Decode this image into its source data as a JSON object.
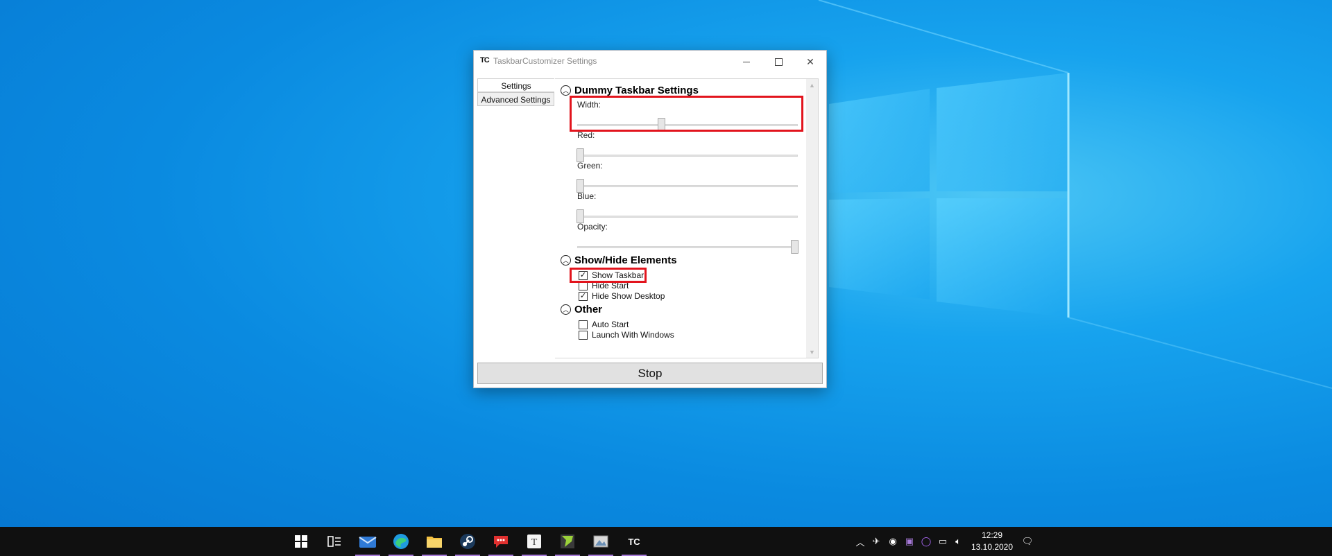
{
  "window": {
    "icon_text": "TC",
    "title": "TaskbarCustomizer Settings"
  },
  "tabs": [
    {
      "label": "Settings",
      "selected": true
    },
    {
      "label": "Advanced Settings",
      "selected": false
    }
  ],
  "sections": {
    "dummy": {
      "title": "Dummy Taskbar Settings",
      "expanded": true
    },
    "showhide": {
      "title": "Show/Hide Elements",
      "expanded": true
    },
    "other": {
      "title": "Other",
      "expanded": true
    }
  },
  "sliders": [
    {
      "label": "Width:",
      "value_fraction": 0.38
    },
    {
      "label": "Red:",
      "value_fraction": 0.0
    },
    {
      "label": "Green:",
      "value_fraction": 0.0
    },
    {
      "label": "Blue:",
      "value_fraction": 0.0
    },
    {
      "label": "Opacity:",
      "value_fraction": 1.0
    }
  ],
  "checkboxes": {
    "show_taskbar": {
      "label": "Show Taskbar",
      "checked": true
    },
    "hide_start": {
      "label": "Hide Start",
      "checked": false
    },
    "hide_show_desktop": {
      "label": "Hide Show Desktop",
      "checked": true
    },
    "auto_start": {
      "label": "Auto Start",
      "checked": false
    },
    "launch_with_windows": {
      "label": "Launch With Windows",
      "checked": false
    }
  },
  "stop_button": {
    "label": "Stop"
  },
  "taskbar": {
    "pinned": [
      "start-icon",
      "task-view-icon",
      "mail-icon",
      "edge-icon",
      "file-explorer-icon",
      "steam-icon",
      "chat-icon",
      "typora-icon",
      "notepadpp-icon",
      "photos-icon",
      "taskbarcustomizer-icon"
    ],
    "tc_label": "TC",
    "time": "12:29",
    "date": "13.10.2020"
  },
  "colors": {
    "highlight_red": "#e2141d",
    "accent": "#a77ad9"
  }
}
